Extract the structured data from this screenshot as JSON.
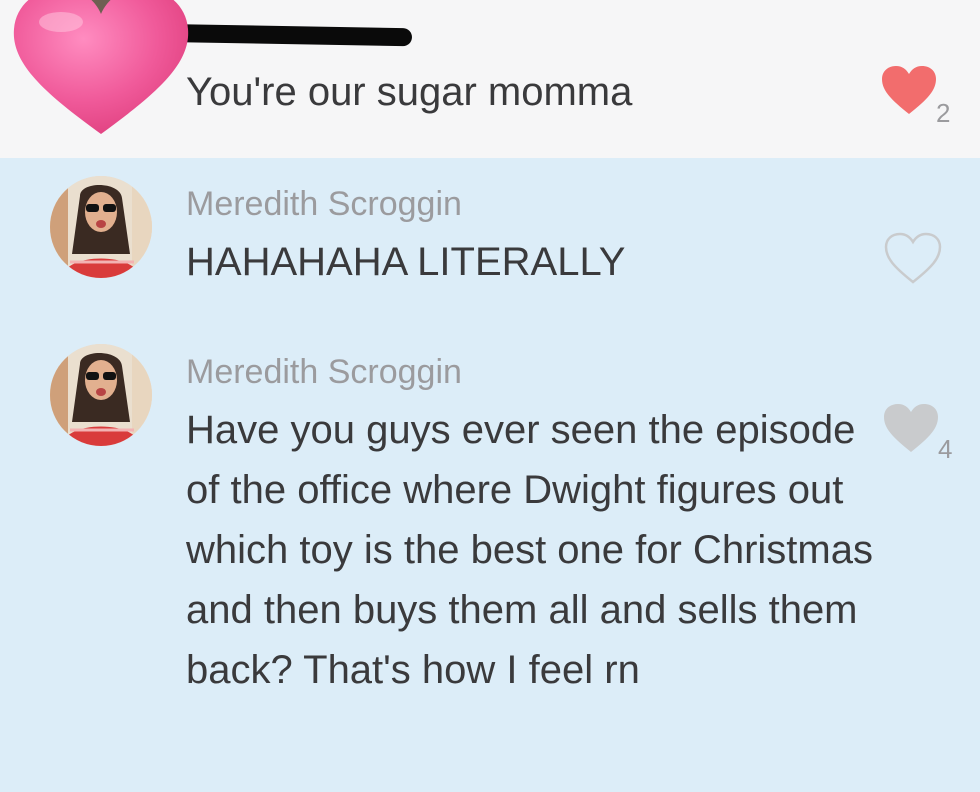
{
  "comments": [
    {
      "text": "You're our sugar momma",
      "likes": "2",
      "liked": true
    },
    {
      "author": "Meredith Scroggin",
      "text": "HAHAHAHA LITERALLY",
      "likes": "",
      "liked": false
    },
    {
      "author": "Meredith Scroggin",
      "text": "Have you guys ever seen the episode of the office where Dwight figures out which toy is the best one for Christmas and then buys them all and sells them back? That's how I feel rn",
      "likes": "4",
      "liked": false
    }
  ],
  "colors": {
    "liked_heart": "#f26d6d",
    "unliked_heart_fill": "#c9cbcd",
    "sticker_heart": "#f05a9a"
  },
  "icons": {
    "like": "heart-icon",
    "sticker": "heart-sticker-icon"
  }
}
